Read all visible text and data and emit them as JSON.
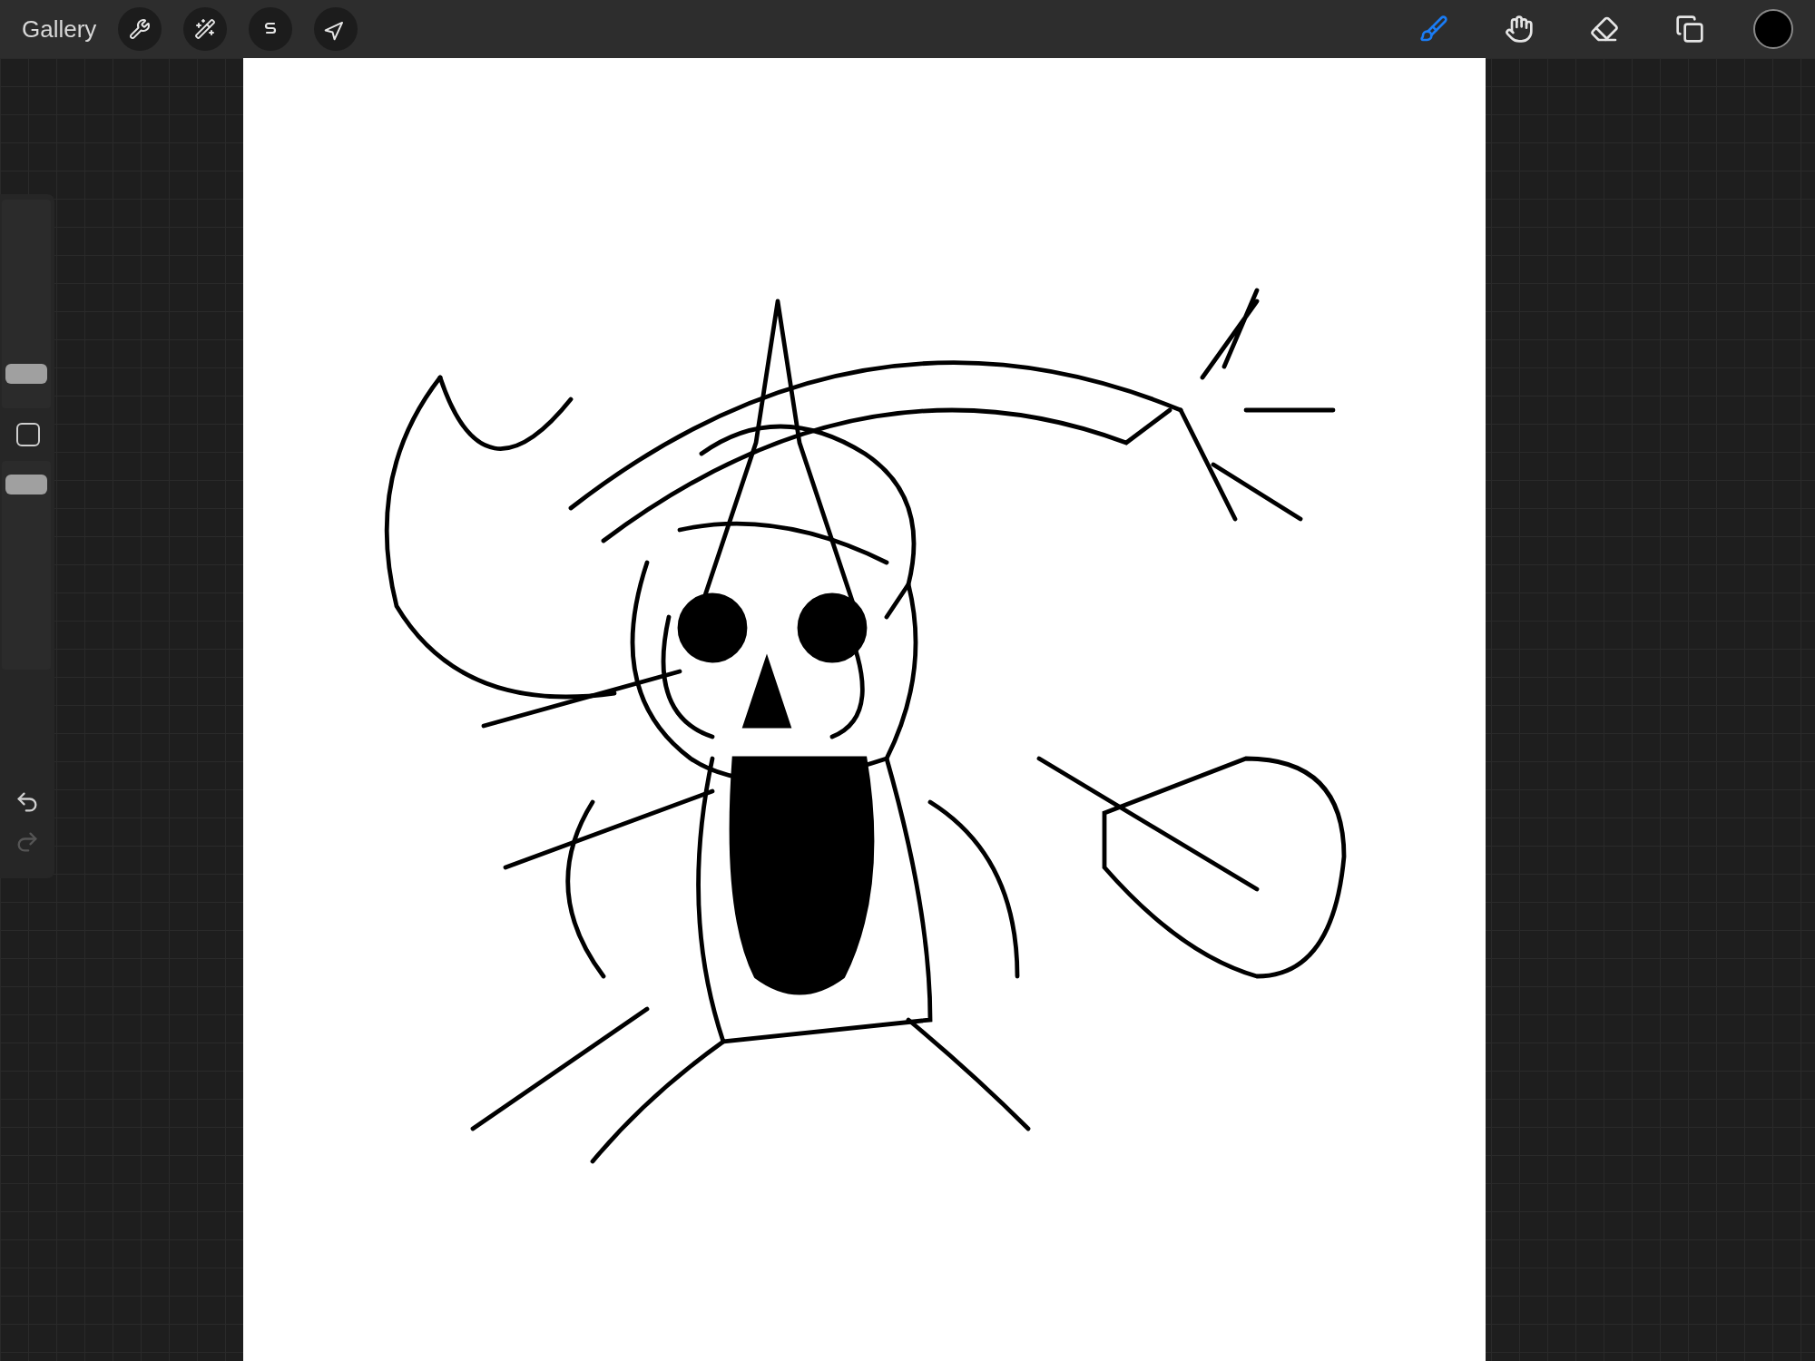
{
  "top_bar": {
    "gallery": "Gallery",
    "actions": [
      {
        "kind": "wrench"
      },
      {
        "kind": "wand"
      },
      {
        "kind": "selection"
      },
      {
        "kind": "transform"
      }
    ],
    "tools": [
      {
        "kind": "brush",
        "selected": true
      },
      {
        "kind": "smudge",
        "selected": false
      },
      {
        "kind": "eraser",
        "selected": false
      },
      {
        "kind": "layers",
        "selected": false
      }
    ],
    "color_swatch": {
      "color": "#000000"
    }
  },
  "sidebar": {
    "brush_size": {
      "level": 0.13
    },
    "opacity": {
      "level": 0.93
    },
    "undo": {
      "disabled": false
    },
    "redo": {
      "disabled": true
    }
  }
}
